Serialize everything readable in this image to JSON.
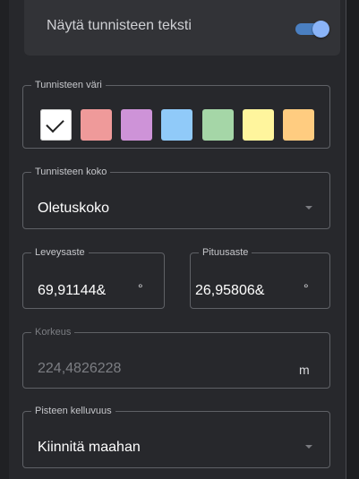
{
  "label_text_toggle": {
    "label": "Näytä tunnisteen teksti",
    "on": true
  },
  "label_color": {
    "legend": "Tunnisteen väri",
    "swatches": [
      {
        "name": "white",
        "color": "#ffffff",
        "selected": true
      },
      {
        "name": "red",
        "color": "#ef9a9a",
        "selected": false
      },
      {
        "name": "purple",
        "color": "#ce93d8",
        "selected": false
      },
      {
        "name": "blue",
        "color": "#90caf9",
        "selected": false
      },
      {
        "name": "green",
        "color": "#a5d6a7",
        "selected": false
      },
      {
        "name": "yellow",
        "color": "#fff59d",
        "selected": false
      },
      {
        "name": "orange",
        "color": "#ffcc80",
        "selected": false
      }
    ]
  },
  "label_size": {
    "legend": "Tunnisteen koko",
    "value": "Oletuskoko"
  },
  "latitude": {
    "legend": "Leveysaste",
    "value": "69,91144&",
    "unit": "°"
  },
  "longitude": {
    "legend": "Pituusaste",
    "value": "26,95806&",
    "unit": "°"
  },
  "altitude": {
    "legend": "Korkeus",
    "value": "224,4826228",
    "unit": "m"
  },
  "point_floating": {
    "legend": "Pisteen kelluvuus",
    "value": "Kiinnitä maahan"
  }
}
